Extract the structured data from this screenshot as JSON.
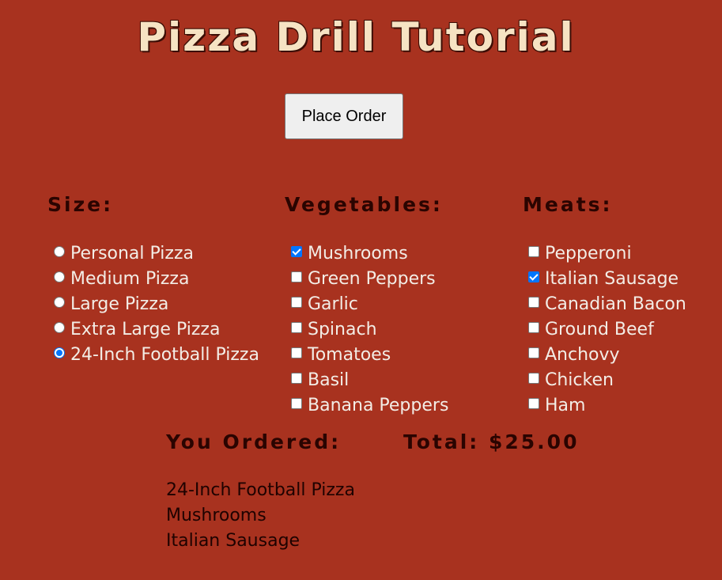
{
  "title": "Pizza Drill Tutorial",
  "place_order_label": "Place Order",
  "size": {
    "heading": "Size:",
    "options": [
      {
        "label": "Personal Pizza",
        "selected": false
      },
      {
        "label": "Medium Pizza",
        "selected": false
      },
      {
        "label": "Large Pizza",
        "selected": false
      },
      {
        "label": "Extra Large Pizza",
        "selected": false
      },
      {
        "label": "24-Inch Football Pizza",
        "selected": true
      }
    ]
  },
  "vegetables": {
    "heading": "Vegetables:",
    "options": [
      {
        "label": "Mushrooms",
        "checked": true
      },
      {
        "label": "Green Peppers",
        "checked": false
      },
      {
        "label": "Garlic",
        "checked": false
      },
      {
        "label": "Spinach",
        "checked": false
      },
      {
        "label": "Tomatoes",
        "checked": false
      },
      {
        "label": "Basil",
        "checked": false
      },
      {
        "label": "Banana Peppers",
        "checked": false
      }
    ]
  },
  "meats": {
    "heading": "Meats:",
    "options": [
      {
        "label": "Pepperoni",
        "checked": false
      },
      {
        "label": "Italian Sausage",
        "checked": true
      },
      {
        "label": "Canadian Bacon",
        "checked": false
      },
      {
        "label": "Ground Beef",
        "checked": false
      },
      {
        "label": "Anchovy",
        "checked": false
      },
      {
        "label": "Chicken",
        "checked": false
      },
      {
        "label": "Ham",
        "checked": false
      }
    ]
  },
  "summary": {
    "you_ordered_label": "You Ordered:",
    "total_label": "Total: $25.00",
    "items": [
      "24-Inch Football Pizza",
      "Mushrooms",
      "Italian Sausage"
    ]
  },
  "colors": {
    "background": "#a8321f",
    "title": "#f6e3c3",
    "accent": "#0075ff"
  }
}
